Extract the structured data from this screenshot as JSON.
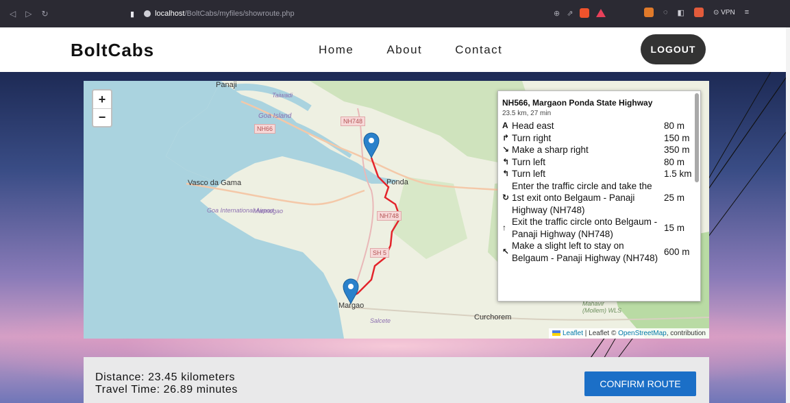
{
  "browser": {
    "url_host": "localhost",
    "url_path": "/BoltCabs/myfiles/showroute.php",
    "vpn_label": "VPN"
  },
  "header": {
    "logo": "BoltCabs",
    "nav": [
      "Home",
      "About",
      "Contact"
    ],
    "logout_label": "LOGOUT"
  },
  "map": {
    "zoom_in": "+",
    "zoom_out": "−",
    "labels": {
      "panaji": "Panaji",
      "taiwadi": "Taiwadi",
      "goa_island": "Goa Island",
      "vasco": "Vasco da Gama",
      "airport": "Goa International Airport",
      "marmugao": "Marmugao",
      "ponda": "Ponda",
      "margao": "Margao",
      "salcete": "Salcete",
      "curchorem": "Curchorem",
      "mahavir": "Mahavir (Mollem) WLS"
    },
    "shields": [
      "NH748",
      "NH66",
      "NH748",
      "SH 5"
    ],
    "attribution": {
      "leaflet": "Leaflet",
      "middle": "| Leaflet ©",
      "osm": "OpenStreetMap",
      "tail": ", contribution"
    }
  },
  "route_panel": {
    "name": "NH566, Margaon Ponda State Highway",
    "meta": "23.5 km, 27 min",
    "steps": [
      {
        "icon": "A",
        "text": "Head east",
        "dist": "80 m"
      },
      {
        "icon": "↱",
        "text": "Turn right",
        "dist": "150 m"
      },
      {
        "icon": "↘",
        "text": "Make a sharp right",
        "dist": "350 m"
      },
      {
        "icon": "↰",
        "text": "Turn left",
        "dist": "80 m"
      },
      {
        "icon": "↰",
        "text": "Turn left",
        "dist": "1.5 km"
      },
      {
        "icon": "↻",
        "text": "Enter the traffic circle and take the 1st exit onto Belgaum - Panaji Highway (NH748)",
        "dist": "25 m"
      },
      {
        "icon": "↑",
        "text": "Exit the traffic circle onto Belgaum - Panaji Highway (NH748)",
        "dist": "15 m"
      },
      {
        "icon": "↖",
        "text": "Make a slight left to stay on Belgaum - Panaji Highway (NH748)",
        "dist": "600 m"
      }
    ]
  },
  "summary": {
    "distance": "Distance: 23.45 kilometers",
    "time": "Travel Time: 26.89 minutes",
    "confirm_label": "CONFIRM ROUTE"
  }
}
